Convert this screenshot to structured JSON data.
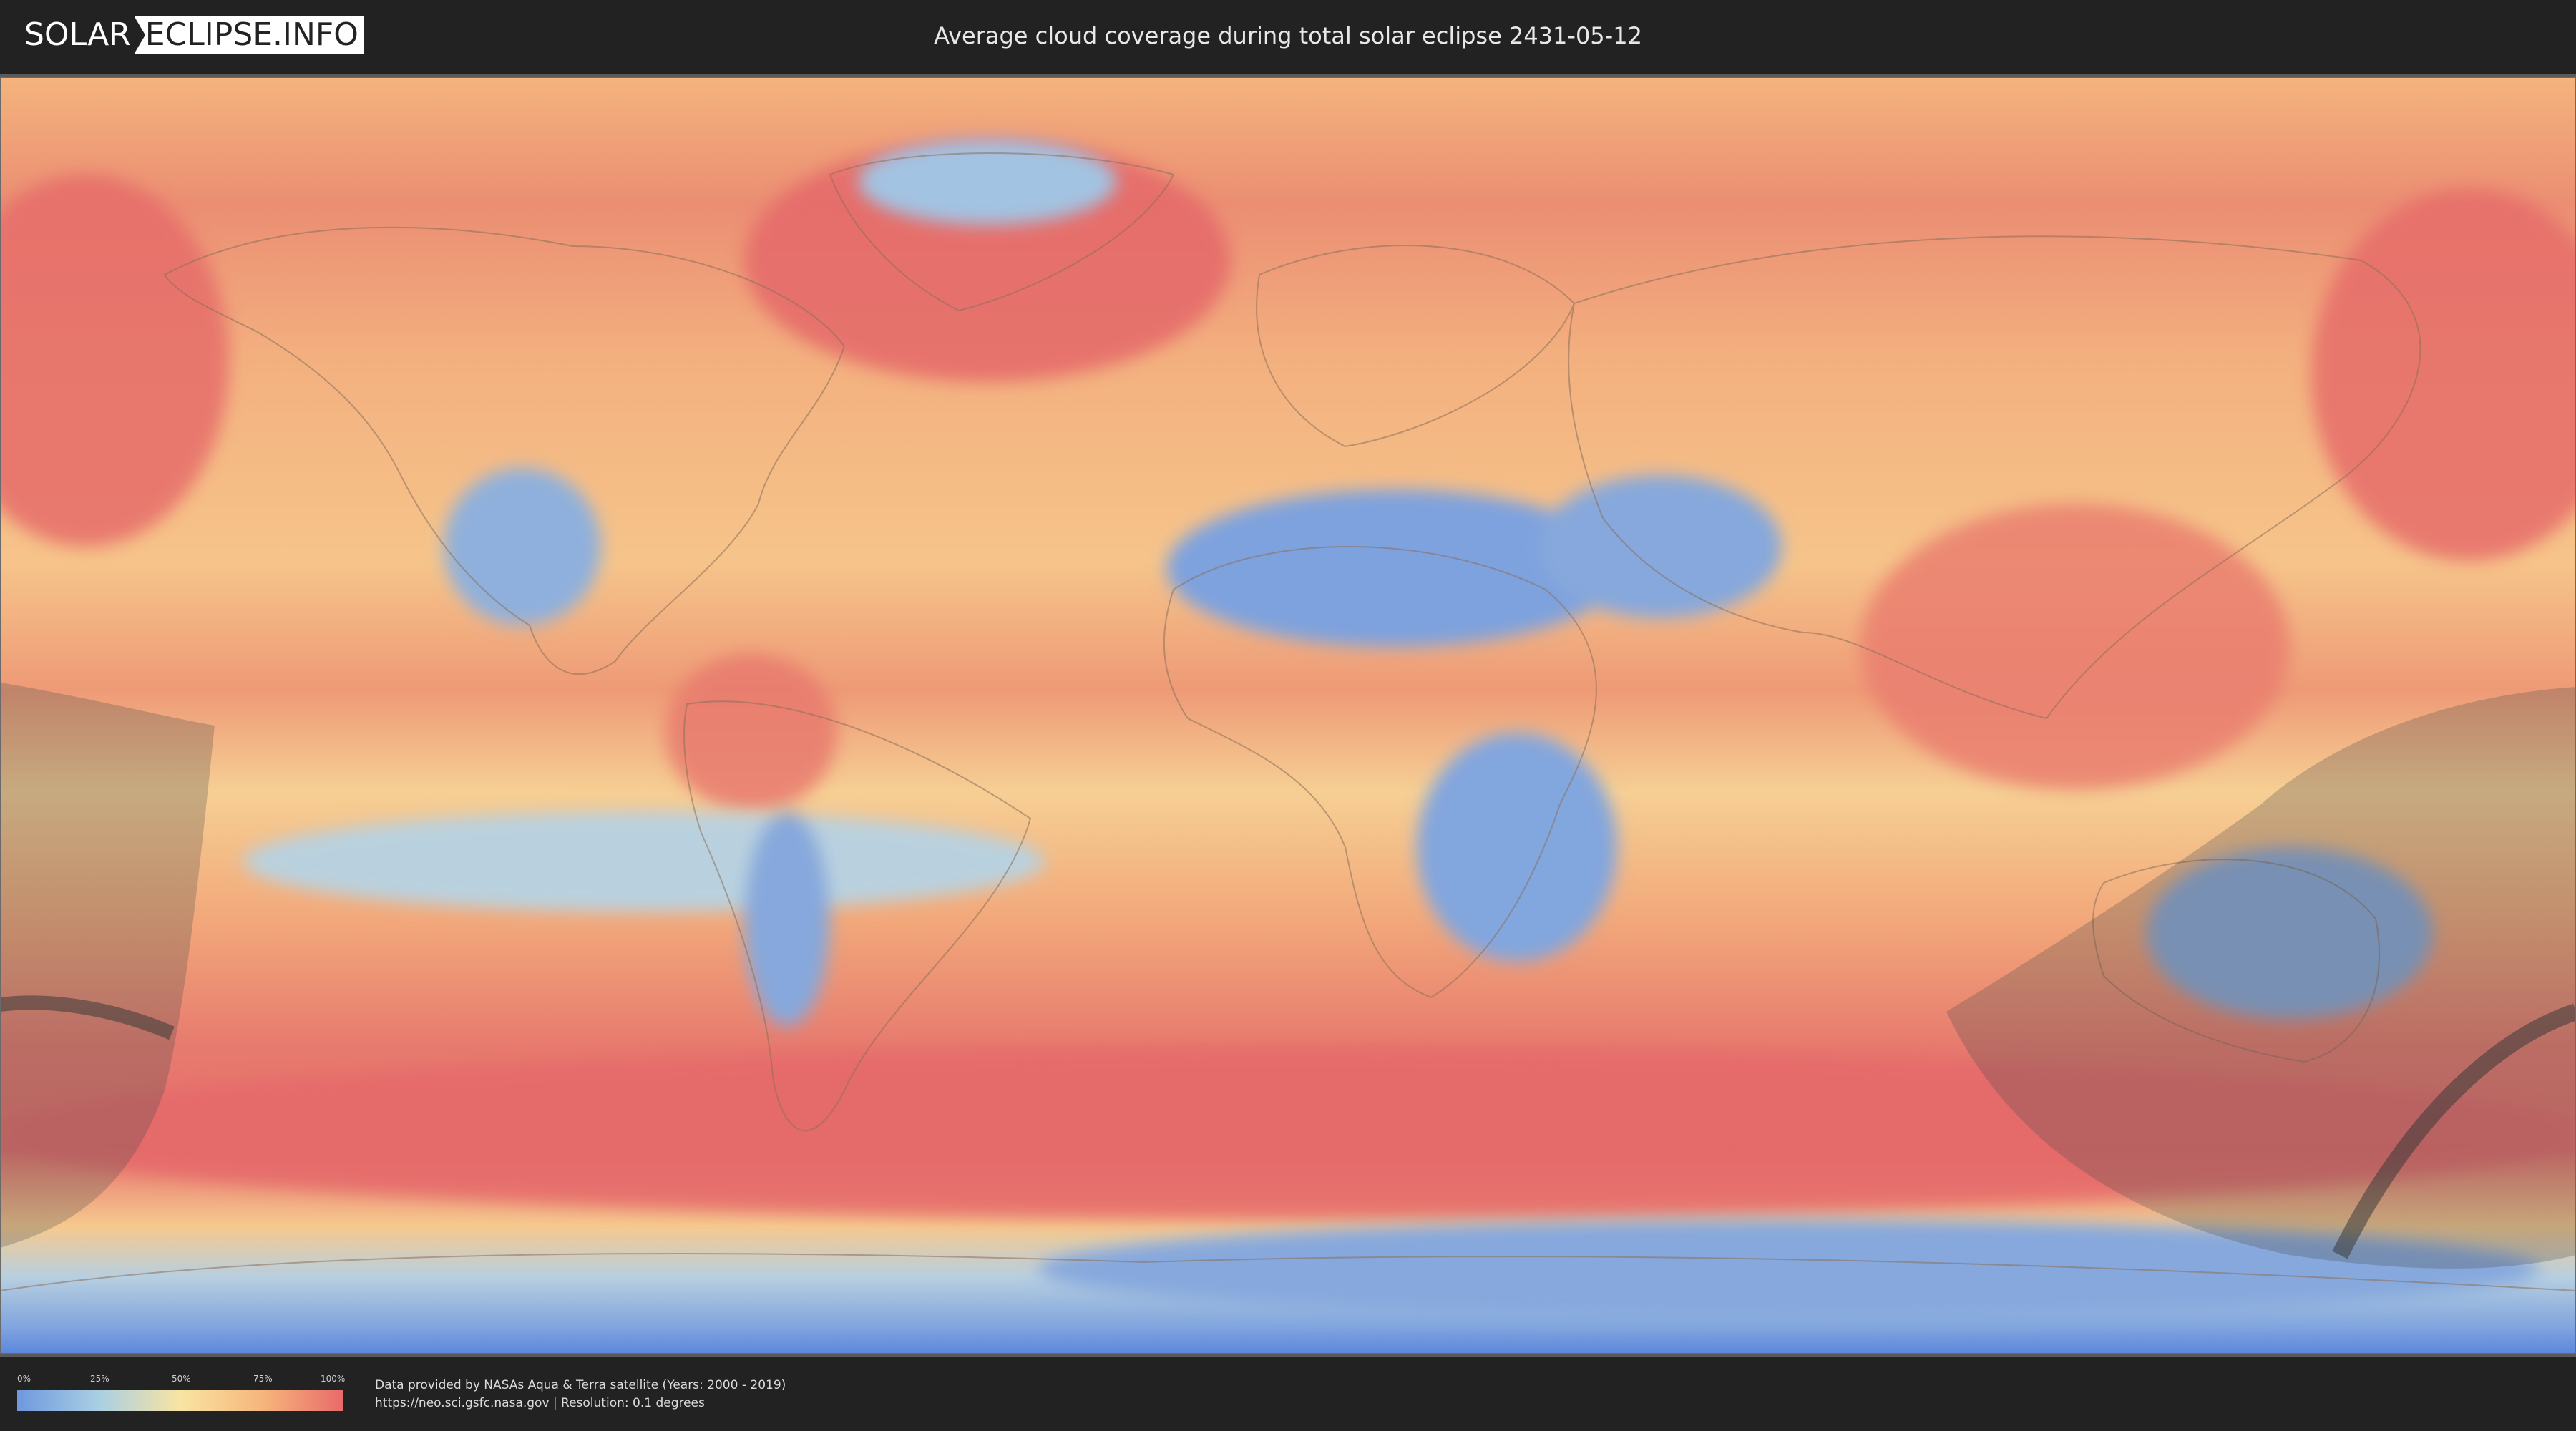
{
  "header": {
    "logo_part1": "SOLAR",
    "logo_part2": "ECLIPSE.INFO",
    "title": "Average cloud coverage during total solar eclipse 2431-05-12"
  },
  "legend": {
    "ticks": [
      "0%",
      "25%",
      "50%",
      "75%",
      "100%"
    ],
    "colors": [
      "#6f98df",
      "#a9cfe3",
      "#f8e4a2",
      "#f6b67c",
      "#e86a6a"
    ]
  },
  "footer": {
    "credit_line1": "Data provided by NASAs Aqua & Terra satellite (Years: 2000 - 2019)",
    "credit_line2": "https://neo.sci.gsfc.nasa.gov | Resolution: 0.1 degrees"
  },
  "map": {
    "ocean_color": "#f0a171",
    "cloudy_color": "#e5696a",
    "clear_color": "#7ea2de",
    "mid_color": "#f8dc9c",
    "shadow_color": "#4d4d4d"
  }
}
